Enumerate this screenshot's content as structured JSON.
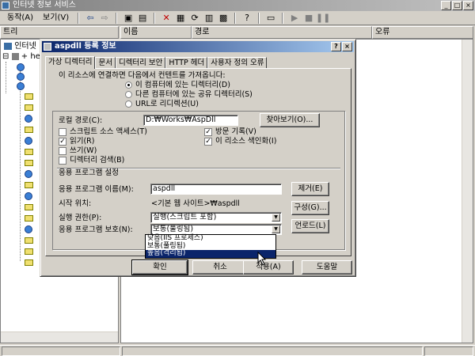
{
  "window": {
    "title": "인터넷 정보 서비스"
  },
  "menu": {
    "action": "동작(A)",
    "view": "보기(V)"
  },
  "headers": {
    "tree": "트리",
    "name": "이름",
    "path": "경로",
    "error": "오류"
  },
  "tree": {
    "root": "인터넷",
    "server": "he"
  },
  "dialog": {
    "title": "aspdll 등록 정보",
    "help_btn": "?",
    "close_btn": "×",
    "tabs": [
      "가상 디렉터리",
      "문서",
      "디렉터리 보안",
      "HTTP 헤더",
      "사용자 정의 오류"
    ],
    "intro": "이 리소스에 연결하면 다음에서 컨텐트를 가져옵니다:",
    "radios": [
      "이 컴퓨터에 있는 디렉터리(D)",
      "다른 컴퓨터에 있는 공유 디렉터리(S)",
      "URL로 리디렉션(U)"
    ],
    "local_path_label": "로컬 경로(C):",
    "local_path_value": "D:₩Works₩AspDll",
    "browse_btn": "찾아보기(O)...",
    "checks_left": [
      {
        "label": "스크립트 소스 액세스(T)",
        "checked": false
      },
      {
        "label": "읽기(R)",
        "checked": true
      },
      {
        "label": "쓰기(W)",
        "checked": false
      },
      {
        "label": "디렉터리 검색(B)",
        "checked": false
      }
    ],
    "checks_right": [
      {
        "label": "방문 기록(V)",
        "checked": true
      },
      {
        "label": "이 리소스 색인화(I)",
        "checked": true
      }
    ],
    "check_mark": "✓",
    "app_settings": "응용 프로그램 설정",
    "app_name_label": "응용 프로그램 이름(M):",
    "app_name_value": "aspdll",
    "remove_btn": "제거(E)",
    "start_point_label": "시작 위치:",
    "start_point_value": "<기본 웹 사이트>₩aspdll",
    "config_btn": "구성(G)...",
    "exec_perm_label": "실행 권한(P):",
    "exec_perm_value": "실행(스크립트 포함)",
    "unload_btn": "언로드(L)",
    "app_protect_label": "응용 프로그램 보호(N):",
    "app_protect_value": "보통(풀링됨)",
    "dropdown_options": [
      {
        "label": "낮음(IIS 프로세스)",
        "selected": false
      },
      {
        "label": "보통(풀링됨)",
        "selected": false
      },
      {
        "label": "높음(격리됨)",
        "selected": true
      }
    ],
    "ok_btn": "확인",
    "cancel_btn": "취소",
    "apply_btn": "적용(A)",
    "help_bottom_btn": "도움말"
  }
}
